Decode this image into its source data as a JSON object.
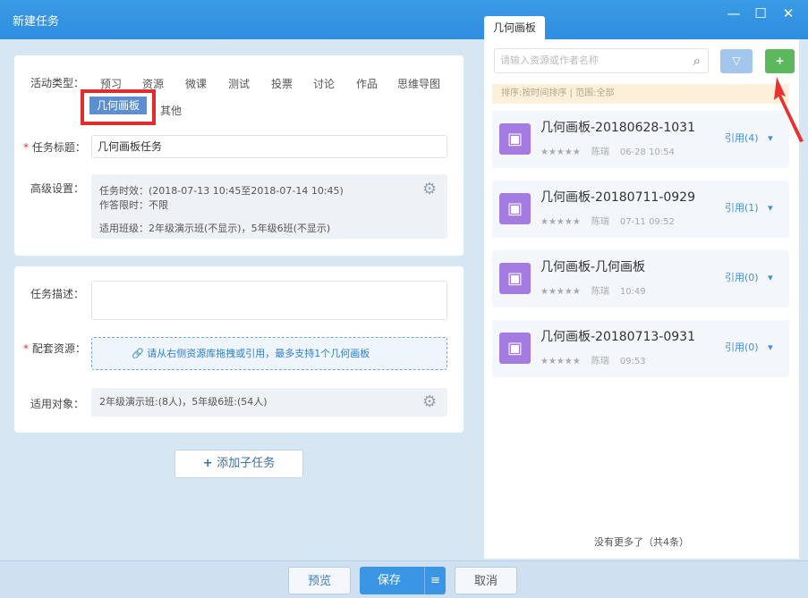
{
  "window": {
    "title": "新建任务",
    "minimize": "—",
    "maximize": "☐",
    "close": "✕"
  },
  "form": {
    "activity_type_label": "活动类型：",
    "types": [
      "预习",
      "资源",
      "微课",
      "测试",
      "投票",
      "讨论",
      "作品",
      "思维导图",
      "几何画板",
      "其他"
    ],
    "selected_type": "几何画板",
    "title_label": "任务标题：",
    "title_value": "几何画板任务",
    "advanced_label": "高级设置：",
    "advanced": {
      "validity": "任务时效：(2018-07-13 10:45至2018-07-14 10:45)",
      "time_limit": "作答限时：不限",
      "classes": "适用班级：2年级演示班(不显示)，5年级6班(不显示)"
    },
    "desc_label": "任务描述：",
    "desc_value": "",
    "resource_label": "配套资源：",
    "resource_hint": "请从右侧资源库拖拽或引用，最多支持1个几何画板",
    "target_label": "适用对象：",
    "target_value": "2年级演示班:(8人)，5年级6班:(54人)",
    "add_subtask": "添加子任务"
  },
  "panel": {
    "tab": "几何画板",
    "search_placeholder": "请输入资源或作者名称",
    "add_button": "+",
    "sort_info": "排序:按时间排序 | 范围:全部",
    "items": [
      {
        "name": "几何画板-20180628-1031",
        "author": "陈瑞",
        "time": "06-28 10:54",
        "ref": "引用(4)"
      },
      {
        "name": "几何画板-20180711-0929",
        "author": "陈瑞",
        "time": "07-11 09:52",
        "ref": "引用(1)"
      },
      {
        "name": "几何画板-几何画板",
        "author": "陈瑞",
        "time": "10:49",
        "ref": "引用(0)"
      },
      {
        "name": "几何画板-20180713-0931",
        "author": "陈瑞",
        "time": "09:53",
        "ref": "引用(0)"
      }
    ],
    "stars": "★★★★★",
    "footer": "没有更多了（共4条）"
  },
  "footer": {
    "preview": "预览",
    "save": "保存",
    "save_menu": "≡",
    "cancel": "取消"
  }
}
